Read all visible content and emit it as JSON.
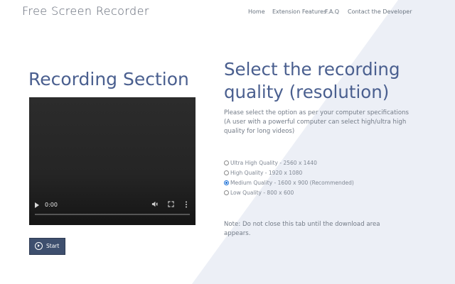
{
  "header": {
    "brand": "Free Screen Recorder",
    "nav": [
      "Home",
      "Extension Features",
      "F.A.Q",
      "Contact the Developer"
    ]
  },
  "recording": {
    "title": "Recording Section",
    "video": {
      "time": "0:00",
      "play_icon": "play-icon",
      "volume_icon": "volume-icon",
      "fullscreen_icon": "fullscreen-icon",
      "more_icon": "more-options-icon"
    },
    "start_button": {
      "label": "Start",
      "icon": "play-circle-icon"
    }
  },
  "quality": {
    "title": "Select the recording quality (resolution)",
    "description": "Please select the option as per your computer specifications (A user with a powerful computer can select high/ultra high quality for long videos)",
    "selected_index": 2,
    "options": [
      "Ultra High Quality - 2560 x 1440",
      "High Quality - 1920 x 1080",
      "Medium Quality - 1600 x 900 (Recommended)",
      "Low Quality - 800 x 600"
    ],
    "note": "Note: Do not close this tab until the download area appears."
  },
  "colors": {
    "accent": "#4a5f8f",
    "button_bg": "#3e4f6e",
    "diagonal_shade": "#eef0f6",
    "radio_selected": "#1a6fd6"
  }
}
